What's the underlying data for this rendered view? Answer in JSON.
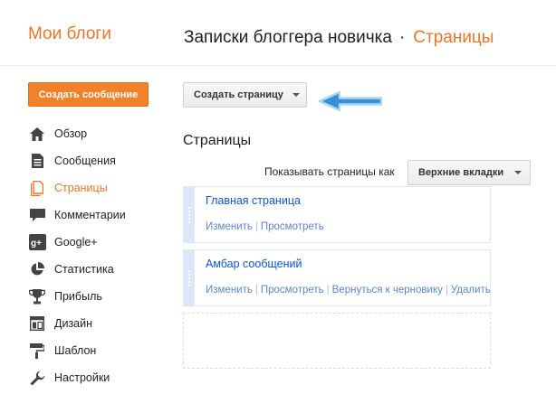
{
  "header": {
    "brand": "Мои блоги",
    "blog_title": "Записки блоггера новичка",
    "separator": "·",
    "section": "Страницы"
  },
  "sidebar": {
    "new_post_label": "Создать сообщение",
    "items": [
      {
        "label": "Обзор",
        "icon": "home-icon"
      },
      {
        "label": "Сообщения",
        "icon": "document-icon"
      },
      {
        "label": "Страницы",
        "icon": "pages-icon",
        "active": true
      },
      {
        "label": "Комментарии",
        "icon": "comment-icon"
      },
      {
        "label": "Google+",
        "icon": "google-plus-icon"
      },
      {
        "label": "Статистика",
        "icon": "pie-chart-icon"
      },
      {
        "label": "Прибыль",
        "icon": "trophy-icon"
      },
      {
        "label": "Дизайн",
        "icon": "layout-icon"
      },
      {
        "label": "Шаблон",
        "icon": "paint-roller-icon"
      },
      {
        "label": "Настройки",
        "icon": "wrench-icon"
      }
    ]
  },
  "main": {
    "create_page_label": "Создать страницу",
    "heading": "Страницы",
    "show_pages_label": "Показывать страницы как",
    "show_pages_value": "Верхние вкладки",
    "pages": [
      {
        "title": "Главная страница",
        "links": [
          "Изменить",
          "Просмотреть"
        ]
      },
      {
        "title": "Амбар сообщений",
        "links": [
          "Изменить",
          "Просмотреть",
          "Вернуться к черновику",
          "Удалить"
        ]
      }
    ]
  },
  "colors": {
    "accent": "#e8762b",
    "link": "#1155cc",
    "arrow": "#3a8fd6"
  }
}
